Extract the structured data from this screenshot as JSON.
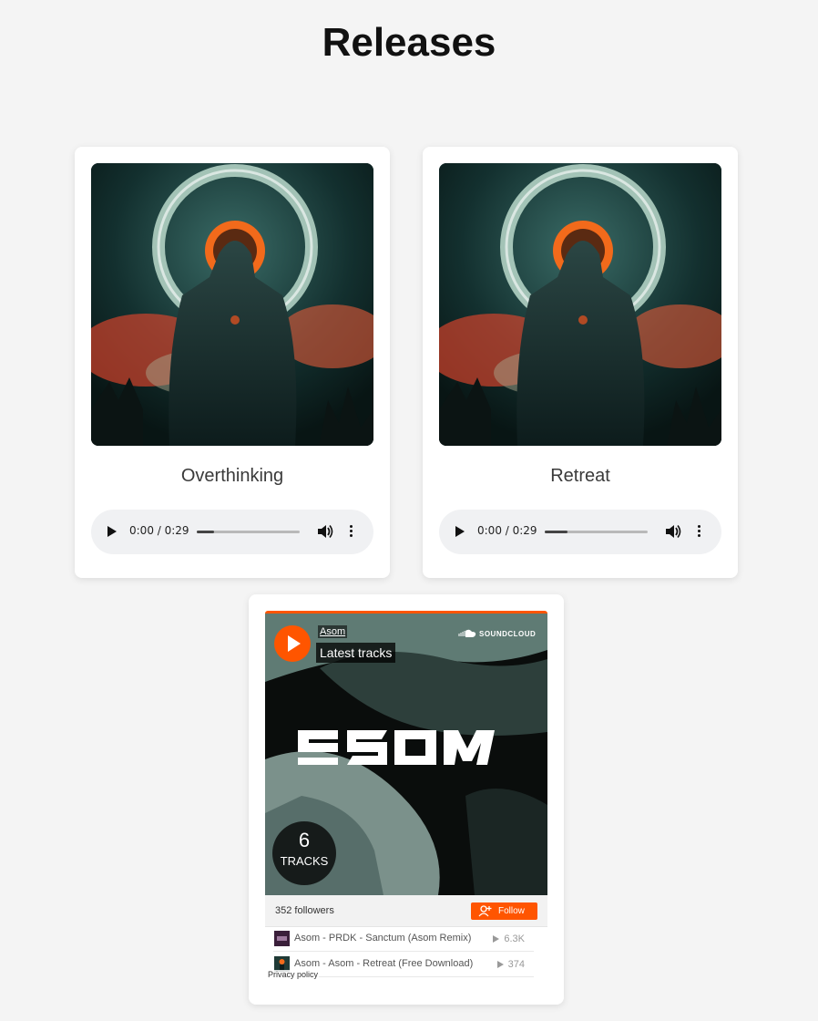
{
  "page": {
    "title": "Releases"
  },
  "releases": [
    {
      "title": "Overthinking",
      "player": {
        "time": "0:00 / 0:29",
        "progress": 0.17
      }
    },
    {
      "title": "Retreat",
      "player": {
        "time": "0:00 / 0:29",
        "progress": 0.22
      }
    }
  ],
  "soundcloud": {
    "artist": "Asom",
    "set_title": "Latest tracks",
    "brand": "SOUNDCLOUD",
    "track_count": "6",
    "track_count_label": "TRACKS",
    "followers": "352 followers",
    "follow_label": "Follow",
    "tracks": [
      {
        "title": "Asom - PRDK - Sanctum (Asom Remix)",
        "plays": "6.3K"
      },
      {
        "title": "Asom - Asom - Retreat (Free Download)",
        "plays": "374"
      }
    ],
    "privacy": "Privacy policy"
  },
  "colors": {
    "accent": "#ff5500",
    "background": "#f4f4f4",
    "card": "#ffffff"
  },
  "icons": [
    "play-icon",
    "volume-icon",
    "more-vert-icon",
    "soundcloud-icon",
    "follow-user-icon"
  ]
}
